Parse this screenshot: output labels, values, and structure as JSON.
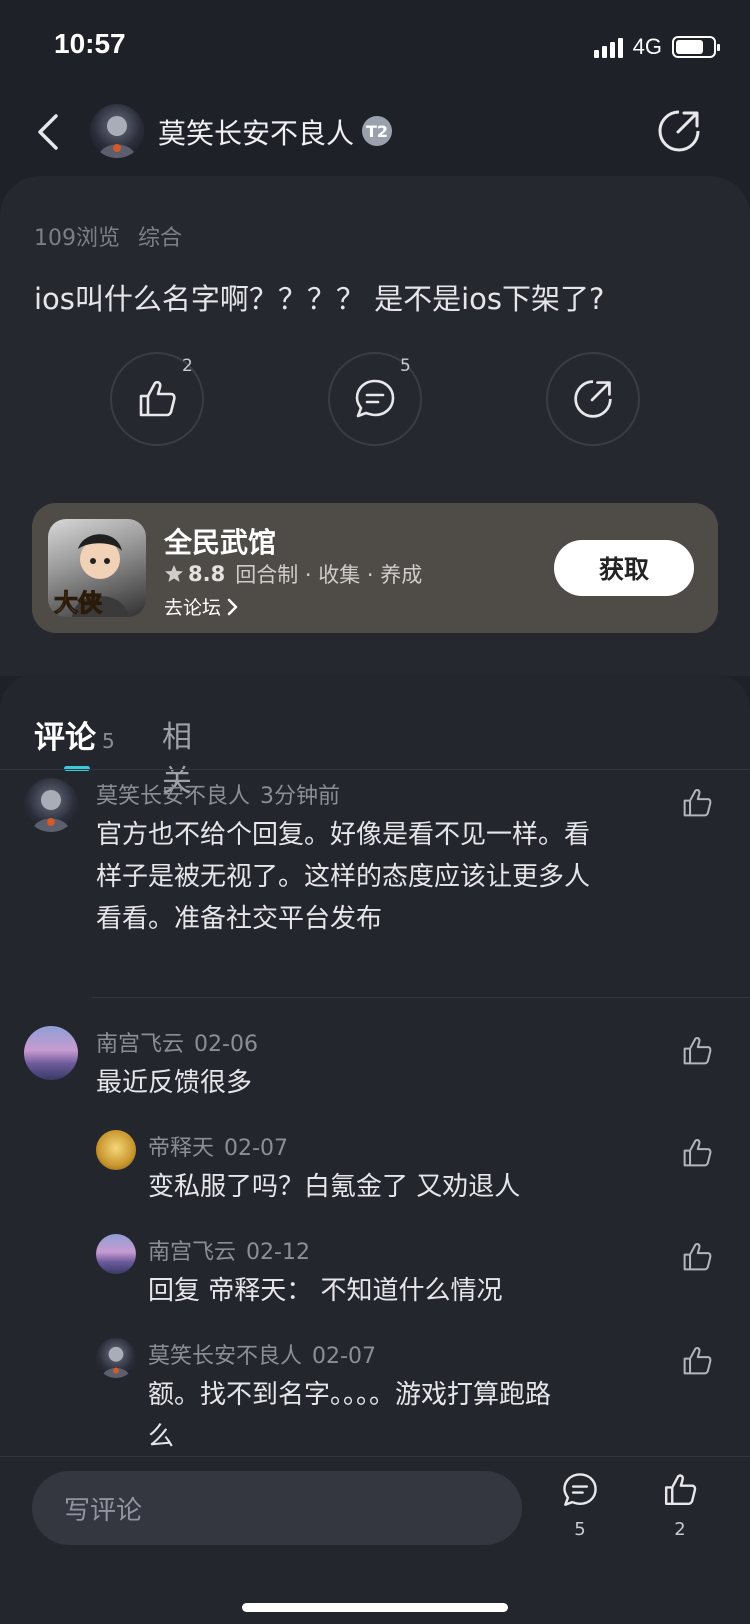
{
  "status_bar": {
    "time": "10:57",
    "network": "4G",
    "battery_level": 0.75
  },
  "nav": {
    "username": "莫笑长安不良人",
    "level_badge": "T2",
    "icons": {
      "back": "chevron-left-icon",
      "share": "share-icon"
    }
  },
  "post": {
    "views": "109浏览",
    "category": "综合",
    "title": "ios叫什么名字啊？？？？ 是不是ios下架了?",
    "like_count": "2",
    "comment_count": "5"
  },
  "game_card": {
    "name": "全民武馆",
    "rating": "8.8",
    "tags": "回合制 · 收集 · 养成",
    "forum_link": "去论坛",
    "get_label": "获取",
    "icon_text": "大侠"
  },
  "tabs": {
    "comments_label": "评论",
    "comments_count": "5",
    "related_label": "相关",
    "accent": "#3ccbd9"
  },
  "comments": [
    {
      "author": "莫笑长安不良人",
      "time": "3分钟前",
      "lines": [
        "官方也不给个回复。好像是看不见一样。看",
        "样子是被无视了。这样的态度应该让更多人",
        "看看。准备社交平台发布"
      ]
    },
    {
      "author": "南宫飞云",
      "time": "02-06",
      "lines": [
        "最近反馈很多"
      ],
      "replies": [
        {
          "author": "帝释天",
          "time": "02-07",
          "text": "变私服了吗？白氪金了 又劝退人"
        },
        {
          "author": "南宫飞云",
          "time": "02-12",
          "text": "回复 帝释天： 不知道什么情况"
        },
        {
          "author": "莫笑长安不良人",
          "time": "02-07",
          "lines": [
            "额。找不到名字。。。。游戏打算跑路",
            "么"
          ]
        }
      ]
    }
  ],
  "bottom_bar": {
    "placeholder": "写评论",
    "comment_count": "5",
    "like_count": "2"
  }
}
